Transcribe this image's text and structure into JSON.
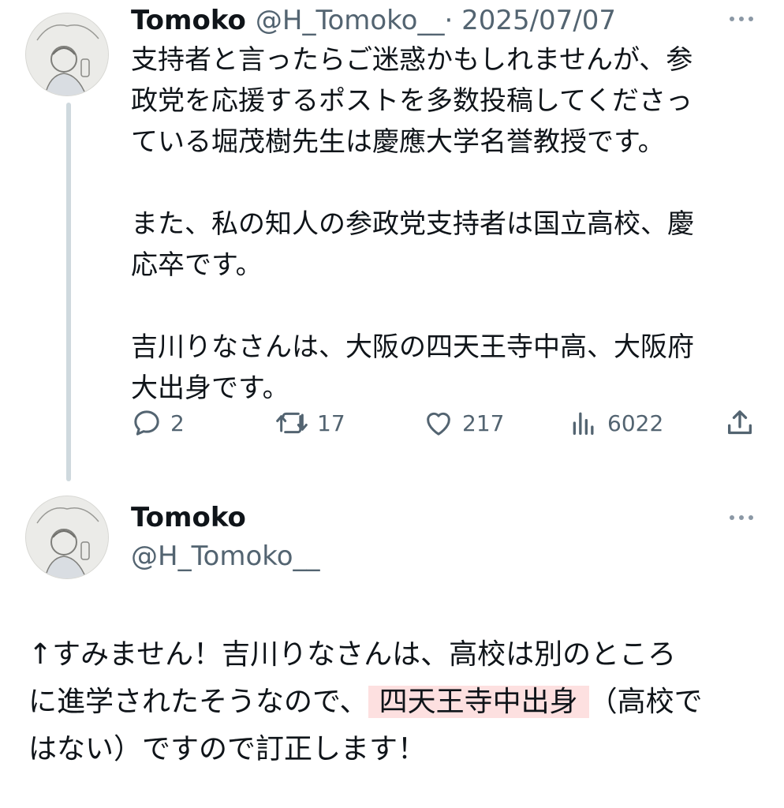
{
  "tweet1": {
    "name": "Tomoko",
    "handle": "@H_Tomoko__",
    "date": "· 2025/07/07",
    "body": "支持者と言ったらご迷惑かもしれませんが、参\n政党を応援するポストを多数投稿してくださっ\nている堀茂樹先生は慶應大学名誉教授です。\n\nまた、私の知人の参政党支持者は国立高校、慶\n応卒です。\n\n吉川りなさんは、大阪の四天王寺中高、大阪府\n大出身です。",
    "actions": {
      "replies": "2",
      "reposts": "17",
      "likes": "217",
      "views": "6022"
    },
    "avatar_icon": "avatar-illustration"
  },
  "tweet2": {
    "name": "Tomoko",
    "handle": "@H_Tomoko__",
    "body_before": "↑すみません！吉川りなさんは、高校は別のところ\nに進学されたそうなので、",
    "body_highlight": "四天王寺中出身",
    "body_after": "（高校で\nはない）ですので訂正します！",
    "highlight_color": "#fde0e0"
  },
  "colors": {
    "text": "#0f1419",
    "muted": "#536471",
    "thread_line": "#cfd9de"
  }
}
